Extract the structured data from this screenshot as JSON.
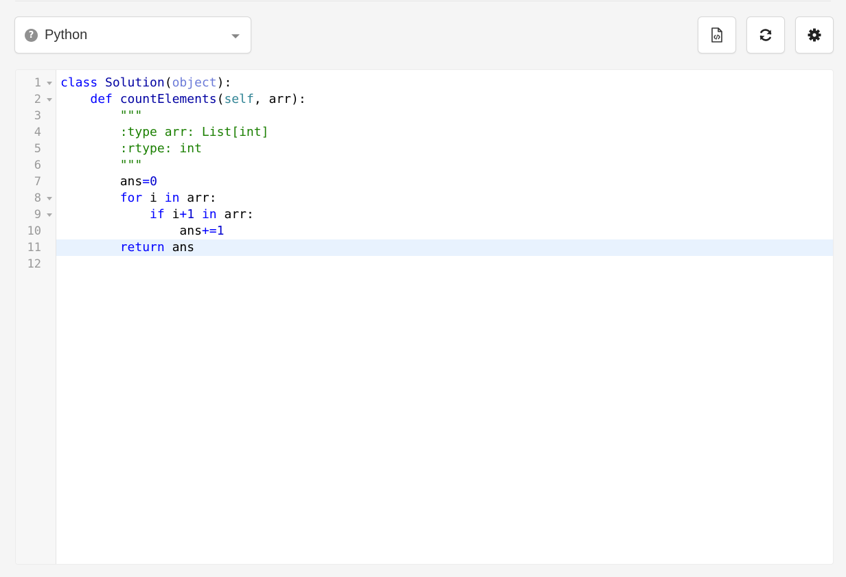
{
  "language_selector": {
    "help_icon": "?",
    "selected": "Python",
    "caret_icon": "chevron-down-icon"
  },
  "toolbar": {
    "buttons": [
      {
        "icon": "code-file-icon",
        "name": "view-code-file"
      },
      {
        "icon": "refresh-icon",
        "name": "reset-code"
      },
      {
        "icon": "gear-icon",
        "name": "settings"
      }
    ]
  },
  "editor": {
    "active_line": 11,
    "line_numbers": [
      "1",
      "2",
      "3",
      "4",
      "5",
      "6",
      "7",
      "8",
      "9",
      "10",
      "11",
      "12"
    ],
    "fold_lines": [
      1,
      2,
      8,
      9
    ],
    "colors": {
      "keyword": "#0000ff",
      "builtin": "#6c7bd8",
      "string": "#1a7f00",
      "active_line_bg": "#e8f2fe"
    },
    "lines": [
      [
        {
          "t": "kw",
          "v": "class"
        },
        {
          "t": "",
          "v": " "
        },
        {
          "t": "cls",
          "v": "Solution"
        },
        {
          "t": "",
          "v": "("
        },
        {
          "t": "builtin",
          "v": "object"
        },
        {
          "t": "",
          "v": "):"
        }
      ],
      [
        {
          "t": "",
          "v": "    "
        },
        {
          "t": "kw",
          "v": "def"
        },
        {
          "t": "",
          "v": " "
        },
        {
          "t": "fn",
          "v": "countElements"
        },
        {
          "t": "",
          "v": "("
        },
        {
          "t": "selfvar",
          "v": "self"
        },
        {
          "t": "",
          "v": ", arr):"
        }
      ],
      [
        {
          "t": "",
          "v": "        "
        },
        {
          "t": "str",
          "v": "\"\"\""
        }
      ],
      [
        {
          "t": "",
          "v": "        "
        },
        {
          "t": "str",
          "v": ":type arr: List[int]"
        }
      ],
      [
        {
          "t": "",
          "v": "        "
        },
        {
          "t": "str",
          "v": ":rtype: int"
        }
      ],
      [
        {
          "t": "",
          "v": "        "
        },
        {
          "t": "str",
          "v": "\"\"\""
        }
      ],
      [
        {
          "t": "",
          "v": "        ans"
        },
        {
          "t": "op",
          "v": "="
        },
        {
          "t": "num",
          "v": "0"
        }
      ],
      [
        {
          "t": "",
          "v": "        "
        },
        {
          "t": "kw",
          "v": "for"
        },
        {
          "t": "",
          "v": " i "
        },
        {
          "t": "kw",
          "v": "in"
        },
        {
          "t": "",
          "v": " arr:"
        }
      ],
      [
        {
          "t": "",
          "v": "            "
        },
        {
          "t": "kw",
          "v": "if"
        },
        {
          "t": "",
          "v": " i"
        },
        {
          "t": "op",
          "v": "+"
        },
        {
          "t": "num",
          "v": "1"
        },
        {
          "t": "",
          "v": " "
        },
        {
          "t": "kw",
          "v": "in"
        },
        {
          "t": "",
          "v": " arr:"
        }
      ],
      [
        {
          "t": "",
          "v": "                ans"
        },
        {
          "t": "op",
          "v": "+="
        },
        {
          "t": "num",
          "v": "1"
        }
      ],
      [
        {
          "t": "",
          "v": "        "
        },
        {
          "t": "kw",
          "v": "return"
        },
        {
          "t": "",
          "v": " ans"
        }
      ],
      [
        {
          "t": "",
          "v": ""
        }
      ]
    ]
  }
}
